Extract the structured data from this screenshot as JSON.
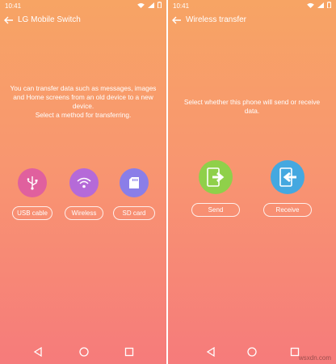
{
  "status_bar": {
    "time": "10:41"
  },
  "screen1": {
    "title": "LG Mobile Switch",
    "message_line1": "You can transfer data such as messages, images",
    "message_line2": "and Home screens from an old device to a new",
    "message_line3": "device.",
    "message_line4": "Select a method for transferring.",
    "options": [
      {
        "label": "USB cable",
        "icon": "usb-icon",
        "color": "#e0609e"
      },
      {
        "label": "Wireless",
        "icon": "wifi-icon",
        "color": "#b56ad8"
      },
      {
        "label": "SD card",
        "icon": "sd-card-icon",
        "color": "#8a7ee8"
      }
    ]
  },
  "screen2": {
    "title": "Wireless transfer",
    "message_line1": "Select whether this phone will send or receive",
    "message_line2": "data.",
    "send": {
      "label": "Send",
      "icon": "send-icon",
      "color": "#8fd04a"
    },
    "receive": {
      "label": "Receive",
      "icon": "receive-icon",
      "color": "#44a8e0"
    }
  },
  "colors": {
    "gradient_top": "#f7a464",
    "gradient_bottom": "#f67b7b"
  },
  "watermark": "wsxdn.com"
}
